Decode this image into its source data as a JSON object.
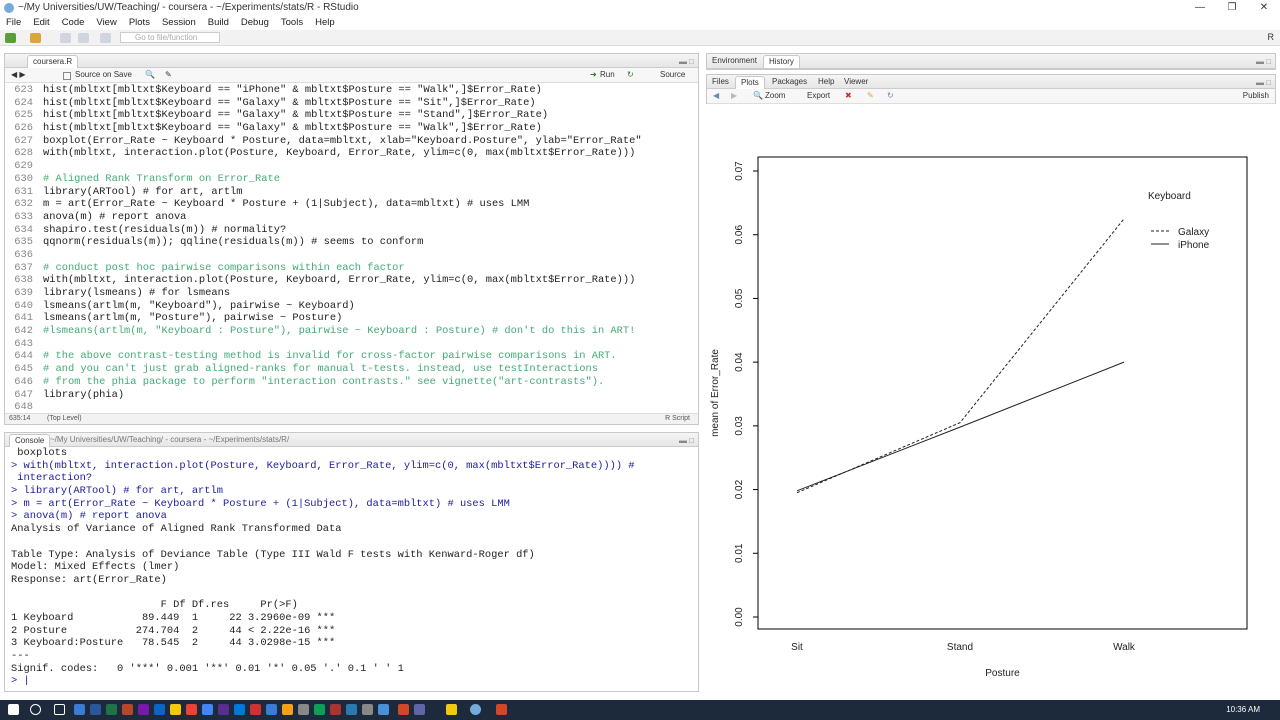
{
  "window": {
    "title": "~/My Universities/UW/Teaching/ - coursera - ~/Experiments/stats/R - RStudio",
    "controls": [
      "—",
      "❐",
      "✕"
    ]
  },
  "menu": [
    "File",
    "Edit",
    "Code",
    "View",
    "Plots",
    "Session",
    "Build",
    "Debug",
    "Tools",
    "Help"
  ],
  "toolbar": {
    "goto_placeholder": "Go to file/function",
    "project": "R"
  },
  "editor": {
    "tab": "coursera.R",
    "source_on_save": "Source on Save",
    "run": "Run",
    "source": "Source",
    "position": "635:14",
    "scope": "(Top Level)",
    "filetype": "R Script",
    "lines": [
      {
        "n": "623",
        "t": "hist(mbltxt[mbltxt$Keyboard == \"iPhone\" & mbltxt$Posture == \"Walk\",]$Error_Rate)"
      },
      {
        "n": "624",
        "t": "hist(mbltxt[mbltxt$Keyboard == \"Galaxy\" & mbltxt$Posture == \"Sit\",]$Error_Rate)"
      },
      {
        "n": "625",
        "t": "hist(mbltxt[mbltxt$Keyboard == \"Galaxy\" & mbltxt$Posture == \"Stand\",]$Error_Rate)"
      },
      {
        "n": "626",
        "t": "hist(mbltxt[mbltxt$Keyboard == \"Galaxy\" & mbltxt$Posture == \"Walk\",]$Error_Rate)"
      },
      {
        "n": "627",
        "t": "boxplot(Error_Rate ~ Keyboard * Posture, data=mbltxt, xlab=\"Keyboard.Posture\", ylab=\"Error_Rate\""
      },
      {
        "n": "628",
        "t": "with(mbltxt, interaction.plot(Posture, Keyboard, Error_Rate, ylim=c(0, max(mbltxt$Error_Rate)))"
      },
      {
        "n": "629",
        "t": ""
      },
      {
        "n": "630",
        "t": "# Aligned Rank Transform on Error_Rate"
      },
      {
        "n": "631",
        "t": "library(ARTool) # for art, artlm"
      },
      {
        "n": "632",
        "t": "m = art(Error_Rate ~ Keyboard * Posture + (1|Subject), data=mbltxt) # uses LMM"
      },
      {
        "n": "633",
        "t": "anova(m) # report anova"
      },
      {
        "n": "634",
        "t": "shapiro.test(residuals(m)) # normality?"
      },
      {
        "n": "635",
        "t": "qqnorm(residuals(m)); qqline(residuals(m)) # seems to conform"
      },
      {
        "n": "636",
        "t": ""
      },
      {
        "n": "637",
        "t": "# conduct post hoc pairwise comparisons within each factor"
      },
      {
        "n": "638",
        "t": "with(mbltxt, interaction.plot(Posture, Keyboard, Error_Rate, ylim=c(0, max(mbltxt$Error_Rate)))"
      },
      {
        "n": "639",
        "t": "library(lsmeans) # for lsmeans"
      },
      {
        "n": "640",
        "t": "lsmeans(artlm(m, \"Keyboard\"), pairwise ~ Keyboard)"
      },
      {
        "n": "641",
        "t": "lsmeans(artlm(m, \"Posture\"), pairwise ~ Posture)"
      },
      {
        "n": "642",
        "t": "#lsmeans(artlm(m, \"Keyboard : Posture\"), pairwise ~ Keyboard : Posture) # don't do this in ART!"
      },
      {
        "n": "643",
        "t": ""
      },
      {
        "n": "644",
        "t": "# the above contrast-testing method is invalid for cross-factor pairwise comparisons in ART."
      },
      {
        "n": "645",
        "t": "# and you can't just grab aligned-ranks for manual t-tests. instead, use testInteractions"
      },
      {
        "n": "646",
        "t": "# from the phia package to perform \"interaction contrasts.\" see vignette(\"art-contrasts\")."
      },
      {
        "n": "647",
        "t": "library(phia)"
      },
      {
        "n": "648",
        "t": ""
      }
    ]
  },
  "console": {
    "tab": "Console",
    "path": "~/My Universities/UW/Teaching/ - coursera - ~/Experiments/stats/R/",
    "lines": [
      {
        "k": "o",
        "t": " boxplots"
      },
      {
        "k": "c",
        "t": "> with(mbltxt, interaction.plot(Posture, Keyboard, Error_Rate, ylim=c(0, max(mbltxt$Error_Rate)))) #"
      },
      {
        "k": "c",
        "t": " interaction?"
      },
      {
        "k": "c",
        "t": "> library(ARTool) # for art, artlm"
      },
      {
        "k": "c",
        "t": "> m = art(Error_Rate ~ Keyboard * Posture + (1|Subject), data=mbltxt) # uses LMM"
      },
      {
        "k": "c",
        "t": "> anova(m) # report anova"
      },
      {
        "k": "o",
        "t": "Analysis of Variance of Aligned Rank Transformed Data"
      },
      {
        "k": "o",
        "t": ""
      },
      {
        "k": "o",
        "t": "Table Type: Analysis of Deviance Table (Type III Wald F tests with Kenward-Roger df)"
      },
      {
        "k": "o",
        "t": "Model: Mixed Effects (lmer)"
      },
      {
        "k": "o",
        "t": "Response: art(Error_Rate)"
      },
      {
        "k": "o",
        "t": ""
      },
      {
        "k": "o",
        "t": "                        F Df Df.res     Pr(>F)    "
      },
      {
        "k": "o",
        "t": "1 Keyboard           89.449  1     22 3.2960e-09 ***"
      },
      {
        "k": "o",
        "t": "2 Posture           274.704  2     44 < 2.22e-16 ***"
      },
      {
        "k": "o",
        "t": "3 Keyboard:Posture   78.545  2     44 3.0298e-15 ***"
      },
      {
        "k": "o",
        "t": "---"
      },
      {
        "k": "o",
        "t": "Signif. codes:   0 '***' 0.001 '**' 0.01 '*' 0.05 '.' 0.1 ' ' 1"
      },
      {
        "k": "c",
        "t": "> |"
      }
    ]
  },
  "env": {
    "tabs": [
      "Environment",
      "History"
    ]
  },
  "files": {
    "tabs": [
      "Files",
      "Plots",
      "Packages",
      "Help",
      "Viewer"
    ],
    "zoom": "Zoom",
    "export": "Export",
    "publish": "Publish"
  },
  "chart_data": {
    "type": "line",
    "x": [
      "Sit",
      "Stand",
      "Walk"
    ],
    "xlabel": "Posture",
    "ylabel": "mean of  Error_Rate",
    "ylim": [
      0,
      0.07
    ],
    "yticks": [
      "0.00",
      "0.01",
      "0.02",
      "0.03",
      "0.04",
      "0.05",
      "0.06",
      "0.07"
    ],
    "legend_title": "Keyboard",
    "series": [
      {
        "name": "Galaxy",
        "values": [
          0.0195,
          0.0305,
          0.0625
        ],
        "style": "dashed"
      },
      {
        "name": "iPhone",
        "values": [
          0.0198,
          0.0298,
          0.04
        ],
        "style": "solid"
      }
    ]
  },
  "taskbar": {
    "clock": "10:36 AM"
  }
}
